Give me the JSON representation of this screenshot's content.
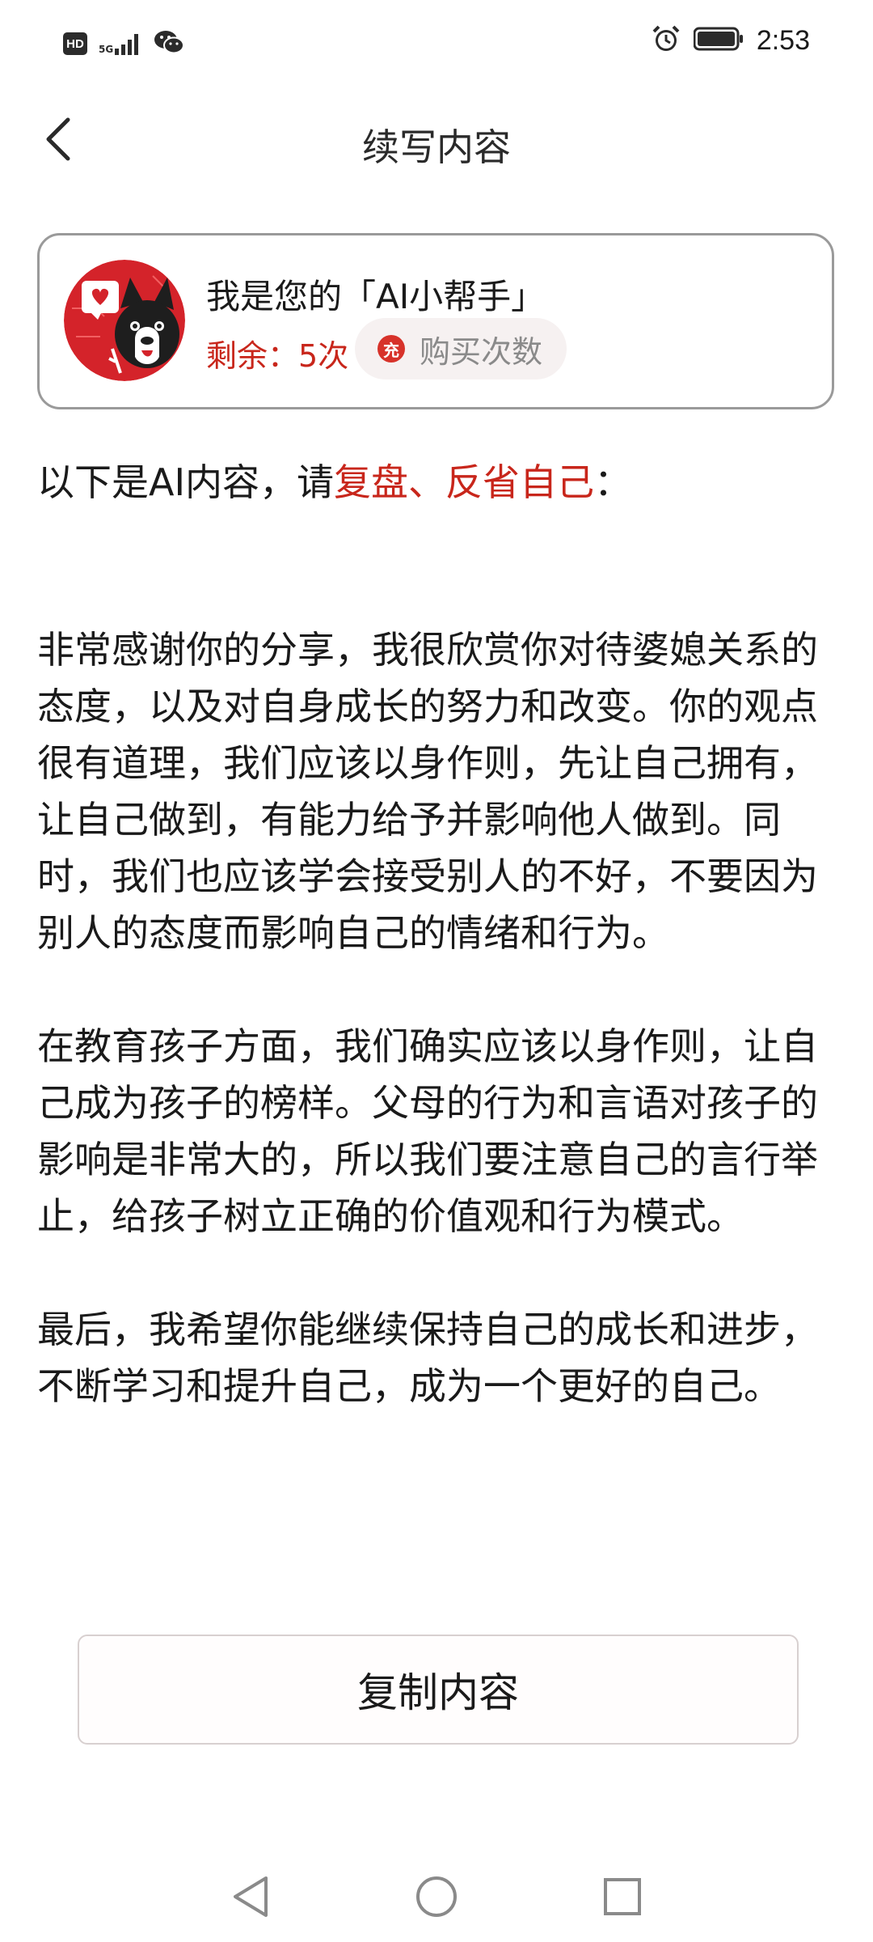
{
  "status_bar": {
    "time": "2:53",
    "network_label": "5G",
    "hd_label": "HD",
    "icons": [
      "hd-icon",
      "signal-icon",
      "wechat-icon",
      "alarm-icon",
      "battery-icon"
    ]
  },
  "header": {
    "title": "续写内容",
    "back_icon": "chevron-left-icon"
  },
  "assistant": {
    "name": "我是您的「AI小帮手」",
    "remaining_label": "剩余：",
    "remaining_count": "5次",
    "buy_icon_text": "充",
    "buy_label": "购买次数",
    "avatar_icon": "dog-mascot-avatar"
  },
  "intro": {
    "prefix": "以下是AI内容，请",
    "highlight": "复盘、反省自己",
    "suffix": "："
  },
  "content": {
    "paragraphs": [
      "非常感谢你的分享，我很欣赏你对待婆媳关系的态度，以及对自身成长的努力和改变。你的观点很有道理，我们应该以身作则，先让自己拥有，让自己做到，有能力给予并影响他人做到。同时，我们也应该学会接受别人的不好，不要因为别人的态度而影响自己的情绪和行为。",
      "在教育孩子方面，我们确实应该以身作则，让自己成为孩子的榜样。父母的行为和言语对孩子的影响是非常大的，所以我们要注意自己的言行举止，给孩子树立正确的价值观和行为模式。",
      "最后，我希望你能继续保持自己的成长和进步，不断学习和提升自己，成为一个更好的自己。"
    ]
  },
  "actions": {
    "copy_label": "复制内容"
  },
  "navigation": {
    "icons": [
      "back-triangle-icon",
      "home-circle-icon",
      "recents-square-icon"
    ]
  },
  "colors": {
    "accent_red": "#c8261b",
    "card_border": "#9a9a9a",
    "buy_button_bg": "#f6f1f1"
  }
}
